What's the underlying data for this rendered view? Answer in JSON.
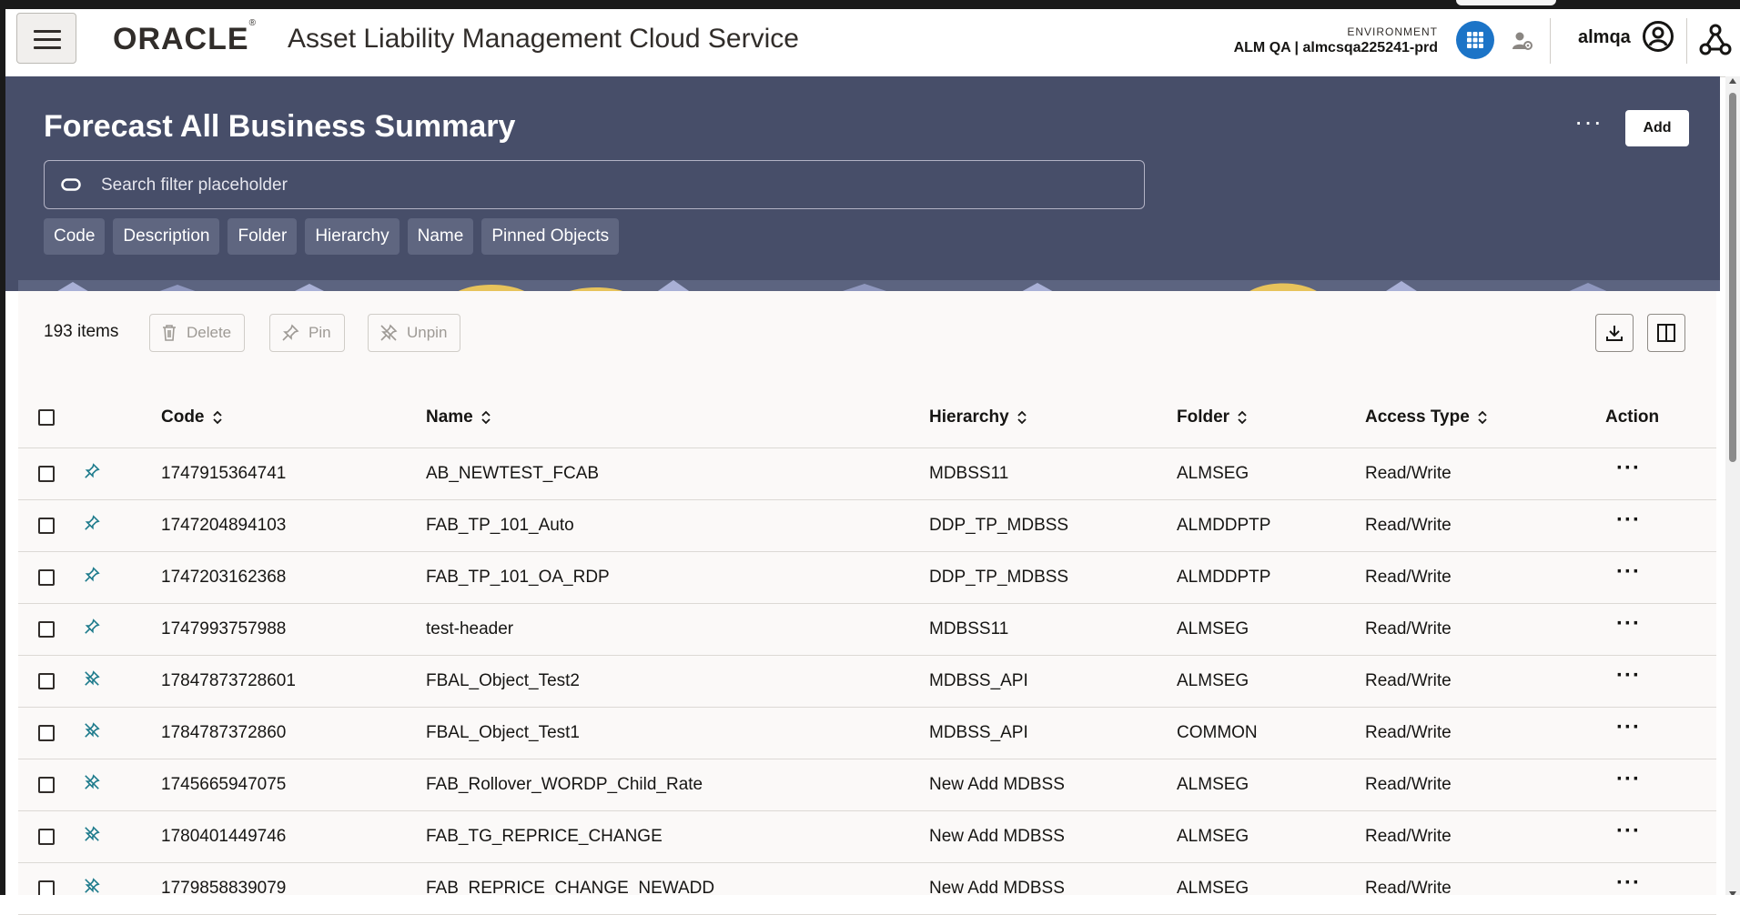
{
  "header": {
    "brand": "ORACLE",
    "app_title": "Asset Liability Management Cloud Service",
    "environment_label": "ENVIRONMENT",
    "environment_value": "ALM QA | almcsqa225241-prd",
    "username": "almqa"
  },
  "page": {
    "title": "Forecast All Business Summary",
    "more_label": "···",
    "add_label": "Add",
    "search": {
      "placeholder": "Search filter placeholder",
      "value": ""
    },
    "filter_chips": [
      "Code",
      "Description",
      "Folder",
      "Hierarchy",
      "Name",
      "Pinned Objects"
    ]
  },
  "toolbar": {
    "item_count": "193 items",
    "delete_label": "Delete",
    "pin_label": "Pin",
    "unpin_label": "Unpin"
  },
  "table": {
    "columns": [
      "Code",
      "Name",
      "Hierarchy",
      "Folder",
      "Access Type",
      "Action"
    ],
    "rows": [
      {
        "pinned": true,
        "code": "1747915364741",
        "name": "AB_NEWTEST_FCAB",
        "hierarchy": "MDBSS11",
        "folder": "ALMSEG",
        "access": "Read/Write",
        "action": "···"
      },
      {
        "pinned": true,
        "code": "1747204894103",
        "name": "FAB_TP_101_Auto",
        "hierarchy": "DDP_TP_MDBSS",
        "folder": "ALMDDPTP",
        "access": "Read/Write",
        "action": "···"
      },
      {
        "pinned": true,
        "code": "1747203162368",
        "name": "FAB_TP_101_OA_RDP",
        "hierarchy": "DDP_TP_MDBSS",
        "folder": "ALMDDPTP",
        "access": "Read/Write",
        "action": "···"
      },
      {
        "pinned": true,
        "code": "1747993757988",
        "name": "test-header",
        "hierarchy": "MDBSS11",
        "folder": "ALMSEG",
        "access": "Read/Write",
        "action": "···"
      },
      {
        "pinned": false,
        "code": "17847873728601",
        "name": "FBAL_Object_Test2",
        "hierarchy": "MDBSS_API",
        "folder": "ALMSEG",
        "access": "Read/Write",
        "action": "···"
      },
      {
        "pinned": false,
        "code": "1784787372860",
        "name": "FBAL_Object_Test1",
        "hierarchy": "MDBSS_API",
        "folder": "COMMON",
        "access": "Read/Write",
        "action": "···"
      },
      {
        "pinned": false,
        "code": "1745665947075",
        "name": "FAB_Rollover_WORDP_Child_Rate",
        "hierarchy": "New Add MDBSS",
        "folder": "ALMSEG",
        "access": "Read/Write",
        "action": "···"
      },
      {
        "pinned": false,
        "code": "1780401449746",
        "name": "FAB_TG_REPRICE_CHANGE",
        "hierarchy": "New Add MDBSS",
        "folder": "ALMSEG",
        "access": "Read/Write",
        "action": "···"
      },
      {
        "pinned": false,
        "code": "1779858839079",
        "name": "FAB_REPRICE_CHANGE_NEWADD",
        "hierarchy": "New Add MDBSS",
        "folder": "ALMSEG",
        "access": "Read/Write",
        "action": "···"
      }
    ]
  },
  "icons": {
    "pinned": "pin-icon",
    "unpinned": "unpin-icon",
    "download": "download-icon",
    "columns": "column-layout-icon"
  },
  "colors": {
    "banner": "#474e69",
    "chip": "#5f6680",
    "apps_button": "#1c74c7",
    "pin_teal": "#1e7b8c"
  }
}
